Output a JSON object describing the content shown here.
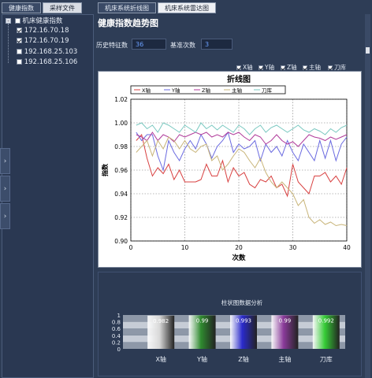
{
  "left_tabs": [
    "健康指数",
    "采样文件"
  ],
  "right_tabs": [
    "机床系统折线图",
    "机床系统雷达图"
  ],
  "tree": {
    "root": "机床健康指数",
    "items": [
      {
        "label": "172.16.70.18",
        "checked": true
      },
      {
        "label": "172.16.70.19",
        "checked": true
      },
      {
        "label": "192.168.25.103",
        "checked": false
      },
      {
        "label": "192.168.25.106",
        "checked": false
      }
    ]
  },
  "side_arrows": [
    "›",
    "›",
    "›"
  ],
  "page_title": "健康指数趋势图",
  "history_label": "历史特征数",
  "history_value": "36",
  "baseline_label": "基准次数",
  "baseline_value": "3",
  "axis_toggles": [
    "X轴",
    "Y轴",
    "Z轴",
    "主轴",
    "刀库"
  ],
  "chart_data": [
    {
      "type": "line",
      "title": "折线图",
      "xlabel": "次数",
      "ylabel": "指数",
      "xlim": [
        0,
        40
      ],
      "ylim": [
        0.9,
        1.02
      ],
      "x_ticks": [
        "0",
        "10",
        "20",
        "30",
        "40"
      ],
      "y_ticks": [
        "0.90",
        "0.92",
        "0.94",
        "0.96",
        "0.98",
        "1.00",
        "1.02"
      ],
      "grid": true,
      "legend": "top",
      "series": [
        {
          "name": "X轴",
          "color": "#d84040",
          "values": [
            0.985,
            0.99,
            0.97,
            0.955,
            0.962,
            0.957,
            0.965,
            0.952,
            0.96,
            0.95,
            0.95,
            0.95,
            0.952,
            0.965,
            0.955,
            0.955,
            0.968,
            0.95,
            0.962,
            0.955,
            0.958,
            0.948,
            0.945,
            0.952,
            0.95,
            0.955,
            0.945,
            0.948,
            0.938,
            0.965,
            0.95,
            0.945,
            0.94,
            0.955,
            0.955,
            0.958,
            0.95,
            0.955,
            0.948,
            0.962
          ]
        },
        {
          "name": "Y轴",
          "color": "#6a6ae0",
          "values": [
            0.992,
            0.985,
            0.99,
            0.99,
            0.972,
            0.96,
            0.985,
            0.975,
            0.968,
            0.978,
            0.985,
            0.978,
            0.99,
            0.982,
            0.97,
            0.98,
            0.985,
            0.992,
            0.975,
            0.982,
            0.978,
            0.98,
            0.985,
            0.968,
            0.982,
            0.975,
            0.98,
            0.972,
            0.985,
            0.975,
            0.968,
            0.982,
            0.975,
            0.968,
            0.985,
            0.97,
            0.985,
            0.968,
            0.982,
            0.988
          ]
        },
        {
          "name": "Z轴",
          "color": "#b03a9a",
          "values": [
            0.99,
            0.988,
            0.985,
            0.992,
            0.985,
            0.99,
            0.988,
            0.984,
            0.99,
            0.988,
            0.99,
            0.992,
            0.99,
            0.992,
            0.988,
            0.99,
            0.988,
            0.992,
            0.99,
            0.992,
            0.988,
            0.985,
            0.99,
            0.988,
            0.982,
            0.985,
            0.99,
            0.985,
            0.982,
            0.984,
            0.98,
            0.985,
            0.99,
            0.988,
            0.987,
            0.985,
            0.988,
            0.986,
            0.988,
            0.99
          ]
        },
        {
          "name": "主轴",
          "color": "#c8b478",
          "values": [
            0.975,
            0.98,
            0.985,
            0.972,
            0.985,
            0.978,
            0.988,
            0.985,
            0.978,
            0.985,
            0.978,
            0.975,
            0.98,
            0.982,
            0.968,
            0.972,
            0.96,
            0.965,
            0.972,
            0.978,
            0.975,
            0.968,
            0.962,
            0.97,
            0.958,
            0.95,
            0.945,
            0.95,
            0.945,
            0.94,
            0.93,
            0.935,
            0.92,
            0.915,
            0.918,
            0.914,
            0.916,
            0.913,
            0.914,
            0.913
          ]
        },
        {
          "name": "刀库",
          "color": "#7ac8c0",
          "values": [
            0.998,
            1.0,
            0.995,
            0.998,
            0.992,
            1.0,
            0.998,
            0.995,
            0.992,
            0.998,
            0.995,
            0.992,
            1.0,
            0.995,
            0.998,
            0.994,
            0.998,
            0.995,
            0.992,
            0.998,
            0.995,
            0.99,
            0.995,
            0.998,
            0.992,
            0.996,
            0.998,
            0.995,
            0.992,
            0.995,
            0.998,
            0.994,
            0.992,
            0.995,
            0.993,
            0.99,
            0.995,
            0.992,
            0.996,
            0.998
          ]
        }
      ]
    },
    {
      "type": "bar",
      "title": "柱状图数据分析",
      "categories": [
        "X轴",
        "Y轴",
        "Z轴",
        "主轴",
        "刀库"
      ],
      "values": [
        0.982,
        0.99,
        0.993,
        0.99,
        0.992
      ],
      "value_labels": [
        "0.982",
        "0.99",
        "0.993",
        "0.99",
        "0.992"
      ],
      "y_ticks": [
        "0",
        "0.2",
        "0.4",
        "0.6",
        "0.8",
        "1"
      ],
      "ylim": [
        0,
        1
      ],
      "colors": [
        "#d8d8d8",
        "#2f8a2f",
        "#2a2acc",
        "#8a3a9a",
        "#35cc35"
      ]
    }
  ]
}
